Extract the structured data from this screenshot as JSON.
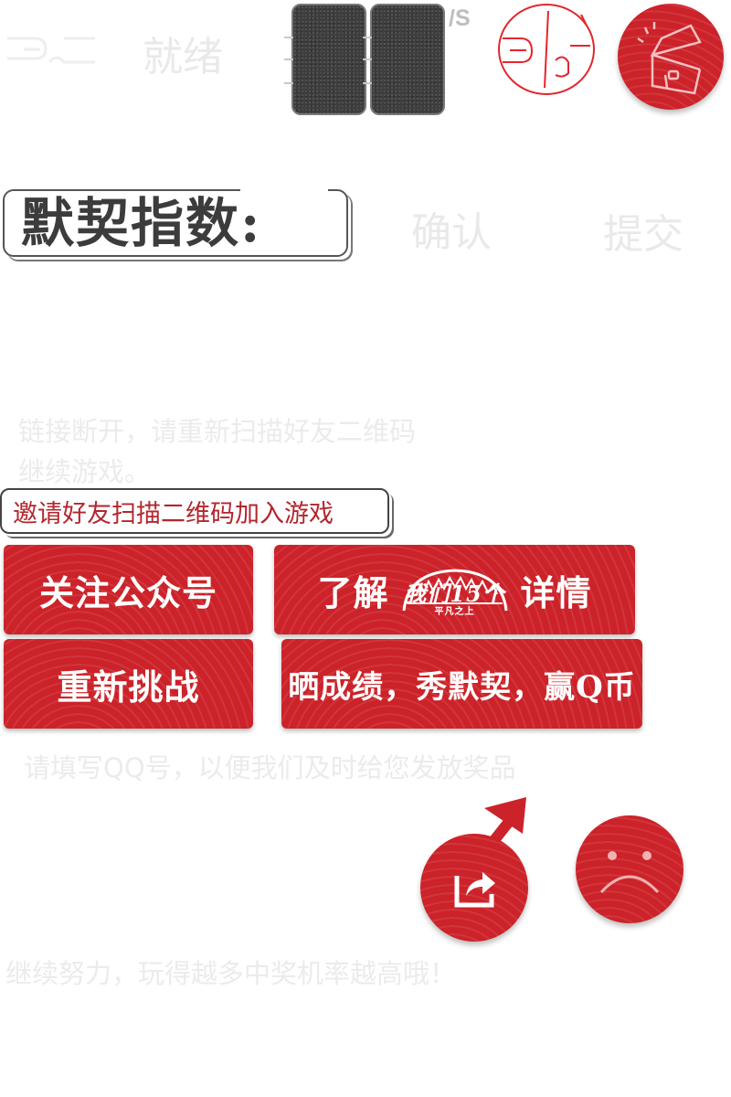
{
  "status": {
    "ready_label": "就绪",
    "speed_unit": "/S"
  },
  "index": {
    "title": "默契指数:",
    "confirm_label": "确认",
    "submit_label": "提交"
  },
  "messages": {
    "disconnected": "链接断开，请重新扫描好友二维码继续游戏。",
    "disconnected_line1": "链接断开，请重新扫描好友二维码",
    "disconnected_line2": "继续游戏。",
    "invite": "邀请好友扫描二维码加入游戏",
    "qq_prompt": "请填写QQ号，以便我们及时给您发放奖品",
    "keep_going": "继续努力，玩得越多中奖机率越高哦！"
  },
  "buttons": {
    "follow": "关注公众号",
    "learn_prefix": "了解",
    "learn_suffix": "详情",
    "learn_logo_text": "我们15个",
    "learn_logo_sub": "平凡之上",
    "retry": "重新挑战",
    "share_score": "晒成绩，秀默契，赢Q币"
  },
  "icons": {
    "top_logo": "logo-mark-icon",
    "cards": "card-icon",
    "seal": "seal-stamp-icon",
    "treasure": "treasure-chest-icon",
    "share": "share-icon",
    "sad": "sad-face-icon"
  },
  "colors": {
    "accent": "#cc2229",
    "text_dark": "#3c3c3c",
    "faint": "#ebebeb"
  }
}
